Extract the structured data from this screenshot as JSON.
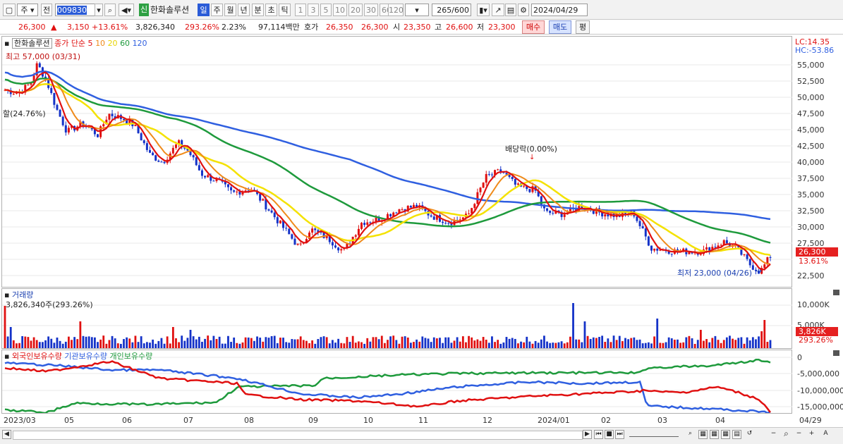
{
  "toolbar": {
    "market": "주",
    "prev_label": "전",
    "code": "009830",
    "badge": "신",
    "name": "한화솔루션",
    "periods": [
      "일",
      "주",
      "월",
      "년",
      "분",
      "초",
      "틱"
    ],
    "ticks": [
      "1",
      "3",
      "5",
      "10",
      "20",
      "30",
      "60",
      "120"
    ],
    "count": "265",
    "count_total": "/600",
    "date": "2024/04/29"
  },
  "quote": {
    "price": "26,300",
    "change": "3,150",
    "change_pct": "+13.61%",
    "volume": "3,826,340",
    "volume_pct": "293.26%",
    "turnover": "2.23%",
    "amount": "97,114백만",
    "hoga_label": "호가",
    "ask": "26,350",
    "bid": "26,300",
    "open_label": "시",
    "open": "23,350",
    "high_label": "고",
    "high": "26,600",
    "low_label": "저",
    "low": "23,300",
    "buy_label": "매수",
    "sell_label": "매도",
    "avg_label": "평"
  },
  "price_panel": {
    "legend_name": "한화솔루션",
    "legend_main": "종가 단순 5",
    "legend_ma": [
      "10",
      "20",
      "60",
      "120"
    ],
    "lc": "LC:14.35",
    "hc": "HC:-53.86",
    "high_note": "최고 57,000 (03/31)",
    "left_note": "할(24.76%)",
    "dividend_note": "배당락(0.00%)",
    "low_note": "최저 23,000 (04/26)",
    "last_price_tag": "26,300",
    "last_pct_tag": "13.61%",
    "y_labels": [
      "55,000",
      "52,500",
      "50,000",
      "47,500",
      "45,000",
      "42,500",
      "40,000",
      "37,500",
      "35,000",
      "32,500",
      "30,000",
      "27,500",
      "22,500"
    ]
  },
  "volume_panel": {
    "title": "거래량",
    "value": "3,826,340주(293.26%)",
    "y_labels": [
      "10,000K",
      "5,000K"
    ],
    "tag": "3,826K",
    "tag_pct": "293.26%"
  },
  "holdings_panel": {
    "legend": [
      "외국인보유수량",
      "기관보유수량",
      "개인보유수량"
    ],
    "y_labels": [
      "0",
      "-5,000,000",
      "-10,000,000",
      "-15,000,000"
    ]
  },
  "x_axis": [
    "2023/03",
    "05",
    "06",
    "07",
    "08",
    "09",
    "10",
    "11",
    "12",
    "2024/01",
    "02",
    "03",
    "04",
    "04/29"
  ],
  "colors": {
    "candle_up": "#e01010",
    "candle_down": "#1432c8",
    "ma5": "#e01010",
    "ma10": "#ef8a1a",
    "ma20": "#f4e200",
    "ma60": "#1e9a3c",
    "ma120": "#2f5fe0",
    "foreign": "#e01010",
    "institution": "#2f5fe0",
    "individual": "#1e9a3c"
  }
}
